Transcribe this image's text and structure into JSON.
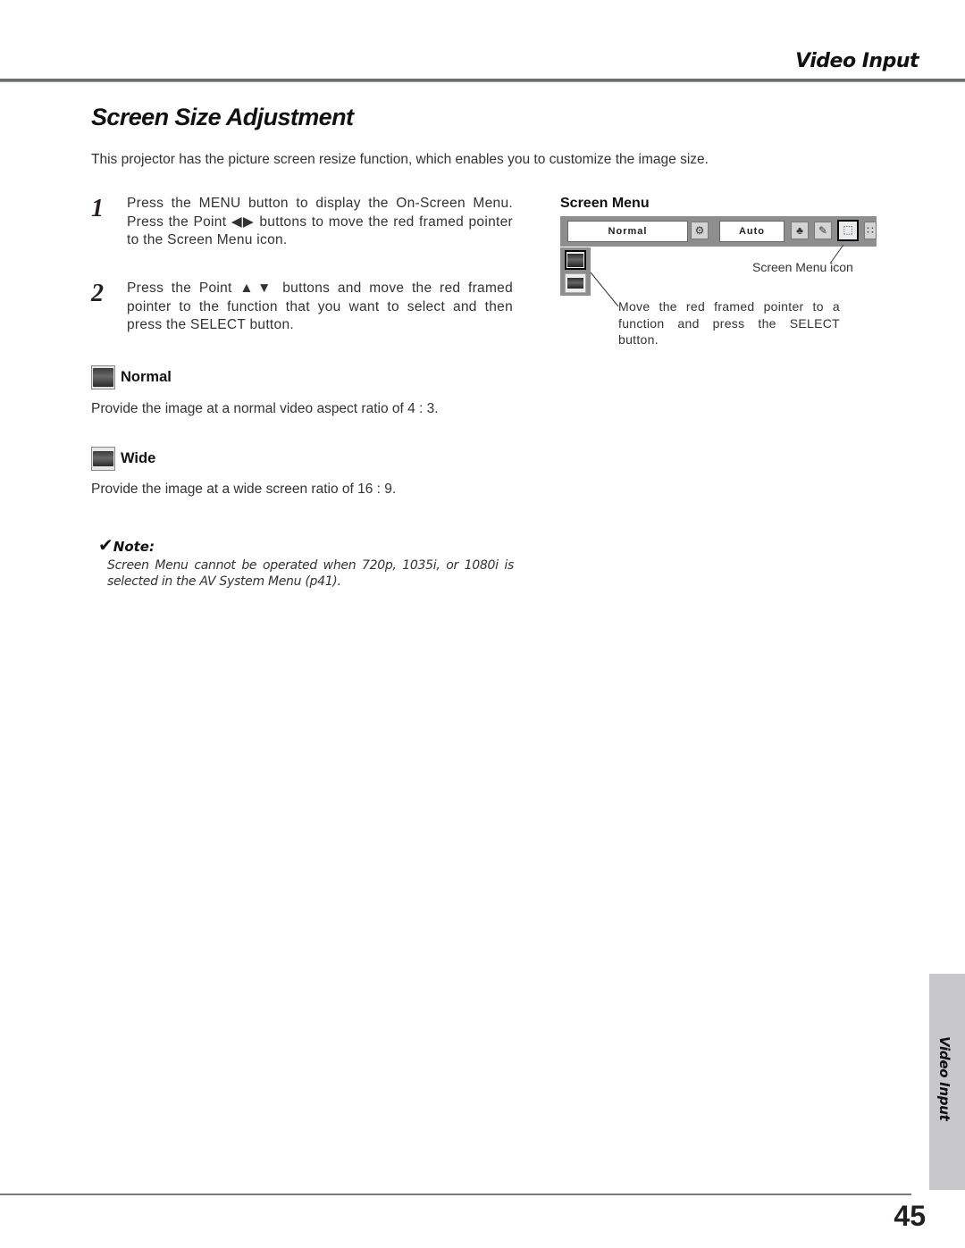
{
  "header": {
    "section_title": "Video Input"
  },
  "page_title": "Screen Size Adjustment",
  "intro": "This projector has the picture screen resize function, which enables you to customize the image size.",
  "steps": [
    {
      "number": "1",
      "text": "Press the MENU button to display the On-Screen Menu.  Press the Point ◀▶ buttons to move the red framed pointer to the Screen Menu icon."
    },
    {
      "number": "2",
      "text": "Press the Point ▲▼ buttons and move the red framed pointer to the function that you want to select and then press the SELECT button."
    }
  ],
  "options": [
    {
      "icon": "normal-screen-icon",
      "label": "Normal",
      "description": "Provide the image at a normal video aspect ratio of 4 : 3."
    },
    {
      "icon": "wide-screen-icon",
      "label": "Wide",
      "description": "Provide the image at a wide screen ratio of 16 : 9."
    }
  ],
  "note": {
    "check_glyph": "✔",
    "heading": "Note:",
    "text": "Screen Menu cannot be operated when 720p, 1035i, or 1080i is selected in the AV System Menu (p41)."
  },
  "screen_menu": {
    "title": "Screen Menu",
    "current_mode": "Normal",
    "source_value": "Auto",
    "toolbar_icons": [
      {
        "name": "input-icon",
        "glyph": "⚙"
      },
      {
        "name": "image-select-icon",
        "glyph": "♣"
      },
      {
        "name": "image-adjust-icon",
        "glyph": "✎"
      },
      {
        "name": "screen-menu-icon",
        "glyph": "⬚",
        "selected": true
      },
      {
        "name": "setting-icon",
        "glyph": "∷"
      }
    ],
    "side_items": [
      {
        "name": "normal",
        "selected": true
      },
      {
        "name": "wide",
        "selected": false
      }
    ],
    "callout_icon": "Screen Menu icon",
    "callout_move": "Move the red framed pointer to a function and press the SELECT button."
  },
  "side_tab": {
    "label": "Video Input"
  },
  "page_number": "45"
}
